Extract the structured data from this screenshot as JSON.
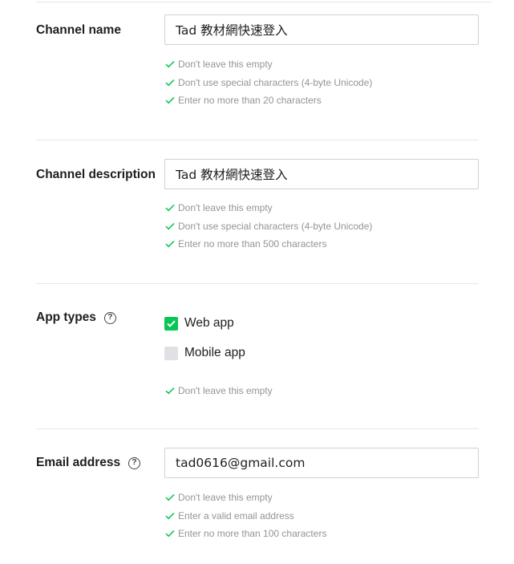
{
  "form": {
    "channel_name": {
      "label": "Channel name",
      "value": "Tad 教材網快速登入",
      "rules": [
        "Don't leave this empty",
        "Don't use special characters (4-byte Unicode)",
        "Enter no more than 20 characters"
      ]
    },
    "channel_description": {
      "label": "Channel description",
      "value": "Tad 教材網快速登入",
      "rules": [
        "Don't leave this empty",
        "Don't use special characters (4-byte Unicode)",
        "Enter no more than 500 characters"
      ]
    },
    "app_types": {
      "label": "App types",
      "help": "?",
      "options": [
        {
          "label": "Web app",
          "checked": true
        },
        {
          "label": "Mobile app",
          "checked": false
        }
      ],
      "rules": [
        "Don't leave this empty"
      ]
    },
    "email_address": {
      "label": "Email address",
      "help": "?",
      "value": "tad0616@gmail.com",
      "rules": [
        "Don't leave this empty",
        "Enter a valid email address",
        "Enter no more than 100 characters"
      ]
    }
  },
  "colors": {
    "valid_check": "#06c755",
    "checkbox_checked": "#06c755",
    "checkbox_unchecked": "#dfe1e5",
    "rule_text": "#949494"
  }
}
